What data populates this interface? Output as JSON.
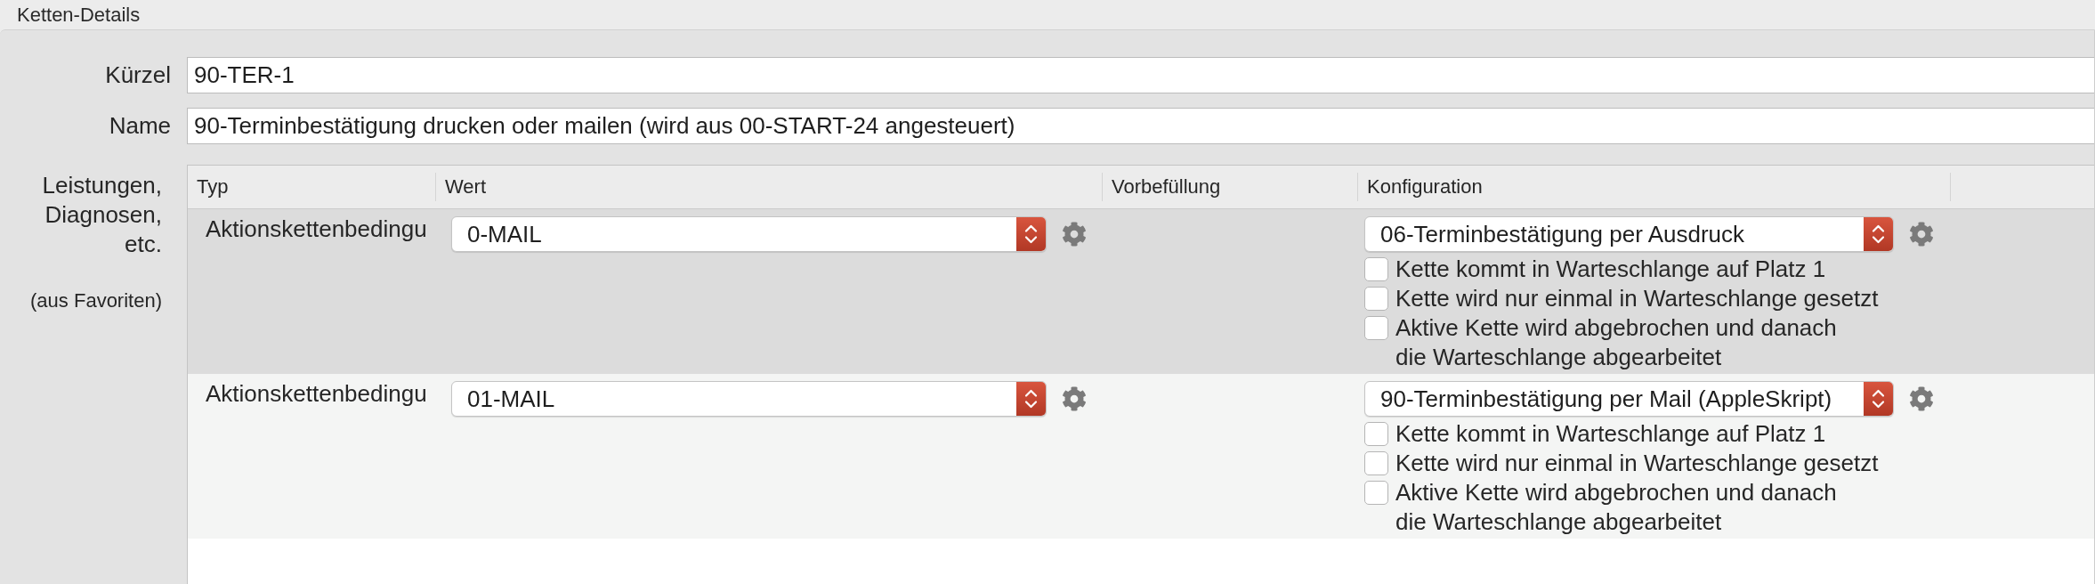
{
  "window": {
    "title": "Ketten-Details"
  },
  "fields": [
    {
      "label": "Kürzel",
      "value": "90-TER-1"
    },
    {
      "label": "Name",
      "value": "90-Terminbestätigung drucken oder mailen (wird aus 00-START-24 angesteuert)"
    }
  ],
  "table": {
    "label": "Leistungen, Diagnosen, etc.",
    "note": "(aus Favoriten)",
    "columns": [
      "Typ",
      "Wert",
      "Vorbefüllung",
      "Konfiguration"
    ],
    "rows": [
      {
        "selected": true,
        "type": "Aktionskettenbedingu",
        "value": "0-MAIL",
        "configuration": "06-Terminbestätigung per Ausdruck",
        "options": [
          {
            "label": "Kette kommt in Warteschlange auf Platz 1",
            "checked": false
          },
          {
            "label": "Kette wird nur einmal in Warteschlange gesetzt",
            "checked": false
          },
          {
            "label": "Aktive Kette wird abgebrochen und danach\ndie Warteschlange abgearbeitet",
            "checked": false
          }
        ]
      },
      {
        "selected": false,
        "type": "Aktionskettenbedingu",
        "value": "01-MAIL",
        "configuration": "90-Terminbestätigung per Mail (AppleSkript)",
        "options": [
          {
            "label": "Kette kommt in Warteschlange auf Platz 1",
            "checked": false
          },
          {
            "label": "Kette wird nur einmal in Warteschlange gesetzt",
            "checked": false
          },
          {
            "label": "Aktive Kette wird abgebrochen und danach\ndie Warteschlange abgearbeitet",
            "checked": false
          }
        ]
      }
    ]
  }
}
